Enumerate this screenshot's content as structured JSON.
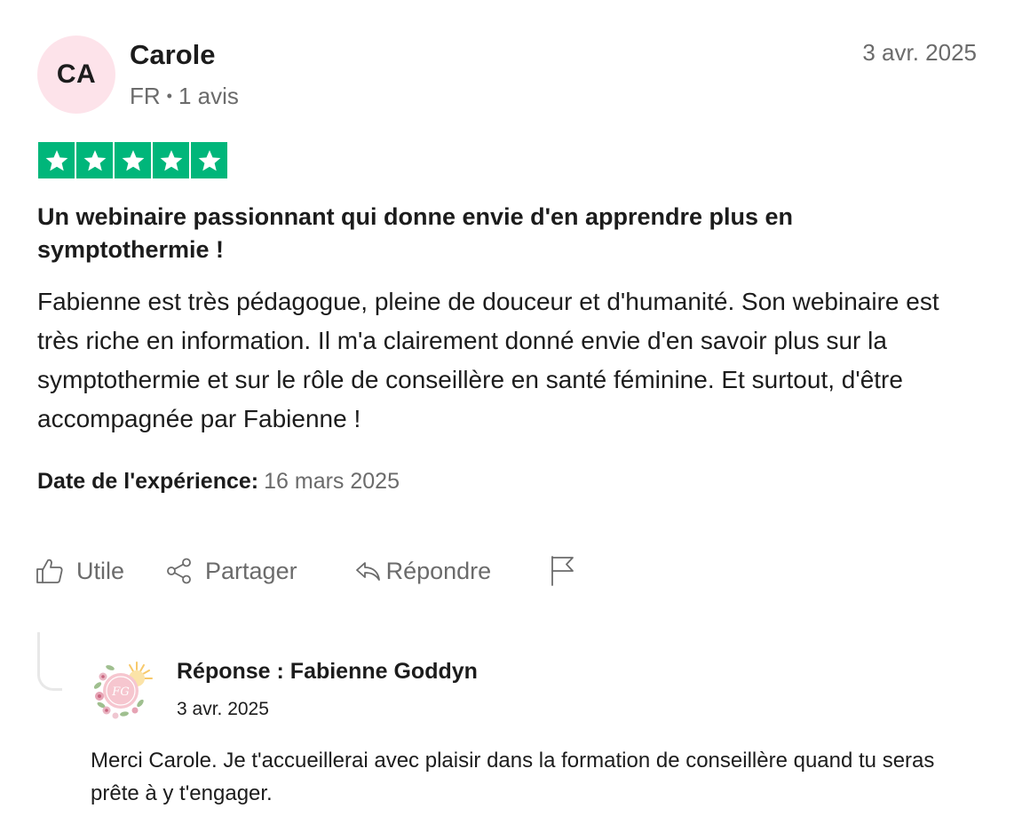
{
  "reviewer": {
    "initials": "CA",
    "name": "Carole",
    "country": "FR",
    "separator": "•",
    "review_count": "1 avis",
    "avatar_color": "#fde3ea"
  },
  "review": {
    "date": "3 avr. 2025",
    "rating": 5,
    "rating_max": 5,
    "star_color": "#00b67a",
    "title": "Un webinaire passionnant qui donne envie d'en apprendre plus en symptothermie !",
    "body": "Fabienne est très pédagogue, pleine de douceur et d'humanité. Son webinaire est très riche en information. Il m'a clairement donné envie d'en savoir plus sur la symptothermie et sur le rôle de conseillère en santé féminine. Et surtout, d'être accompagnée par Fabienne !",
    "experience_label": "Date de l'expérience:",
    "experience_date": "16 mars 2025"
  },
  "actions": {
    "useful_label": "Utile",
    "useful_icon": "thumbs-up-icon",
    "share_label": "Partager",
    "share_icon": "share-icon",
    "reply_label": "Répondre",
    "reply_icon": "reply-icon",
    "report_icon": "flag-icon"
  },
  "reply": {
    "title": "Réponse : Fabienne Goddyn",
    "date": "3 avr. 2025",
    "body": "Merci Carole. Je t'accueillerai avec plaisir dans la formation de conseillère quand tu seras prête à y t'engager.",
    "logo_icon": "floral-logo-icon"
  }
}
